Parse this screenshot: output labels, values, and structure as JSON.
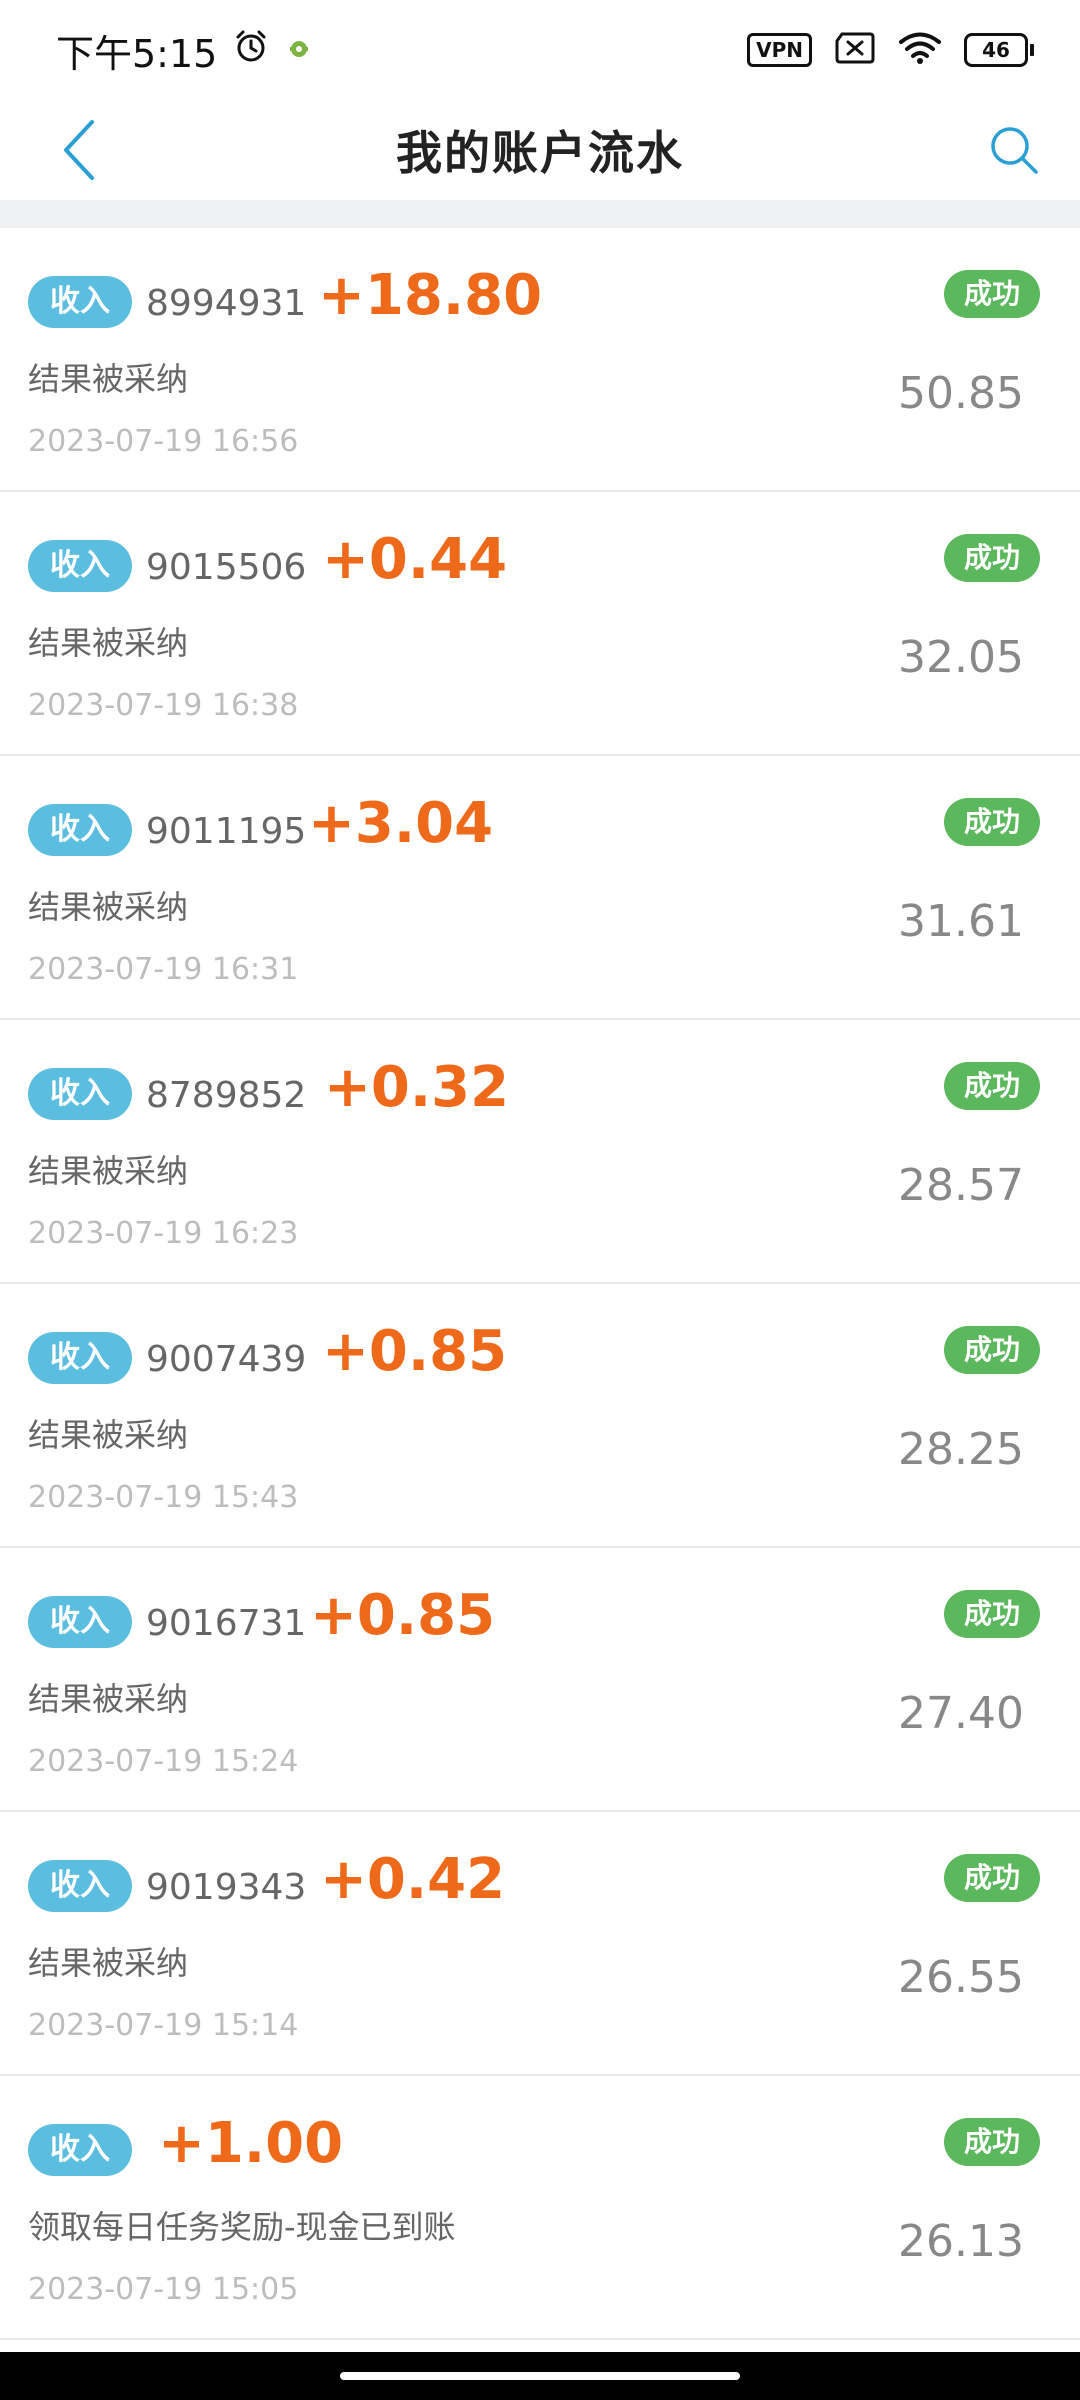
{
  "status_bar": {
    "time": "下午5:15",
    "vpn_label": "VPN",
    "battery_level": "46"
  },
  "header": {
    "title": "我的账户流水"
  },
  "transactions": [
    {
      "type": "收入",
      "id": "8994931",
      "amount": "+18.80",
      "status": "成功",
      "description": "结果被采纳",
      "time": "2023-07-19 16:56",
      "balance": "50.85"
    },
    {
      "type": "收入",
      "id": "9015506",
      "amount": "+0.44",
      "status": "成功",
      "description": "结果被采纳",
      "time": "2023-07-19 16:38",
      "balance": "32.05"
    },
    {
      "type": "收入",
      "id": "9011195",
      "amount": "+3.04",
      "status": "成功",
      "description": "结果被采纳",
      "time": "2023-07-19 16:31",
      "balance": "31.61"
    },
    {
      "type": "收入",
      "id": "8789852",
      "amount": "+0.32",
      "status": "成功",
      "description": "结果被采纳",
      "time": "2023-07-19 16:23",
      "balance": "28.57"
    },
    {
      "type": "收入",
      "id": "9007439",
      "amount": "+0.85",
      "status": "成功",
      "description": "结果被采纳",
      "time": "2023-07-19 15:43",
      "balance": "28.25"
    },
    {
      "type": "收入",
      "id": "9016731",
      "amount": "+0.85",
      "status": "成功",
      "description": "结果被采纳",
      "time": "2023-07-19 15:24",
      "balance": "27.40"
    },
    {
      "type": "收入",
      "id": "9019343",
      "amount": "+0.42",
      "status": "成功",
      "description": "结果被采纳",
      "time": "2023-07-19 15:14",
      "balance": "26.55"
    },
    {
      "type": "收入",
      "id": "",
      "amount": "+1.00",
      "status": "成功",
      "description": "领取每日任务奖励-现金已到账",
      "time": "2023-07-19 15:05",
      "balance": "26.13"
    }
  ],
  "colors": {
    "income_badge": "#5bbde0",
    "amount_text": "#ee6a1a",
    "success_badge": "#5cb85c",
    "accent": "#2a9fd6"
  }
}
